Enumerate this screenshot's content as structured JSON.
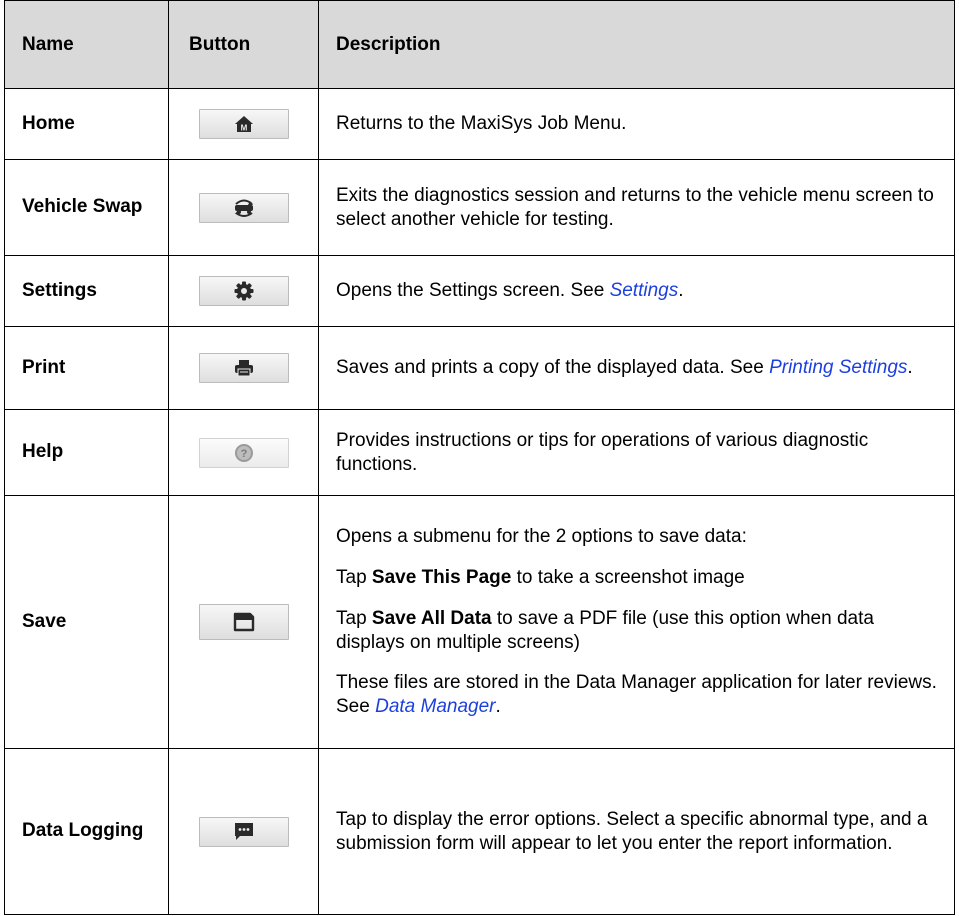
{
  "headers": {
    "name": "Name",
    "button": "Button",
    "description": "Description"
  },
  "rows": [
    {
      "name": "Home",
      "icon": "home-icon",
      "desc": [
        "Returns to the MaxiSys Job Menu."
      ]
    },
    {
      "name": "Vehicle Swap",
      "icon": "vehicle-swap-icon",
      "desc": [
        "Exits the diagnostics session and returns to the vehicle menu screen to select another vehicle for testing."
      ]
    },
    {
      "name": "Settings",
      "icon": "gear-icon",
      "desc_pre": "Opens the Settings screen. See ",
      "desc_link": "Settings",
      "desc_post": "."
    },
    {
      "name": "Print",
      "icon": "printer-icon",
      "desc_pre": "Saves and prints a copy of the displayed data. See ",
      "desc_link": "Printing Settings",
      "desc_post": "."
    },
    {
      "name": "Help",
      "icon": "help-icon",
      "desc": [
        "Provides instructions or tips for operations of various diagnostic functions."
      ]
    },
    {
      "name": "Save",
      "icon": "save-icon",
      "p1": "Opens a submenu for the 2 options to save data:",
      "p2_pre": "Tap ",
      "p2_bold": "Save This Page",
      "p2_post": " to take a screenshot image",
      "p3_pre": "Tap ",
      "p3_bold": "Save All Data",
      "p3_post": " to save a PDF file (use this option when data displays on multiple screens)",
      "p4_pre": "These files are stored in the Data Manager application for later reviews. See ",
      "p4_link": "Data Manager",
      "p4_post": "."
    },
    {
      "name": "Data Logging",
      "icon": "chat-icon",
      "desc": [
        "Tap to display the error options. Select a specific abnormal type, and a submission form will appear to let you enter the report information."
      ]
    }
  ],
  "colors": {
    "header_bg": "#d9d9d9",
    "link": "#1c3fe0",
    "icon": "#2a2a2a"
  }
}
